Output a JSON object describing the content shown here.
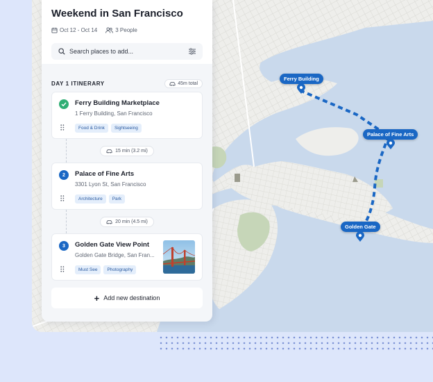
{
  "itinerary": {
    "title": "Weekend in San Francisco",
    "dates": "Oct 12 - Oct 14",
    "people": "3 People",
    "search_placeholder": "Search places to add...",
    "day_title": "DAY 1 ITINERARY",
    "total": "45m total",
    "stops": [
      {
        "number": "",
        "status": "done",
        "name": "Ferry Building Marketplace",
        "address": "1 Ferry Building, San Francisco",
        "tags": [
          "Food & Drink",
          "Sightseeing"
        ]
      },
      {
        "number": "2",
        "status": "pending",
        "name": "Palace of Fine Arts",
        "address": "3301 Lyon St, San Francisco",
        "tags": [
          "Architecture",
          "Park"
        ]
      },
      {
        "number": "3",
        "status": "pending",
        "name": "Golden Gate View Point",
        "address": "Golden Gate Bridge, San Fran...",
        "tags": [
          "Must See",
          "Photography"
        ]
      }
    ],
    "legs": [
      "15 min (3.2 mi)",
      "20 min (4.5 mi)"
    ],
    "add_label": "Add new destination"
  },
  "map": {
    "markers": [
      "Ferry Building",
      "Palace of Fine Arts",
      "Golden Gate"
    ],
    "route_color": "#1a67c4",
    "water_color": "#c9d9ec",
    "land_color": "#eeeeeb"
  },
  "colors": {
    "accent": "#1a67c4",
    "done": "#2fae74",
    "background": "#dde6fb"
  }
}
